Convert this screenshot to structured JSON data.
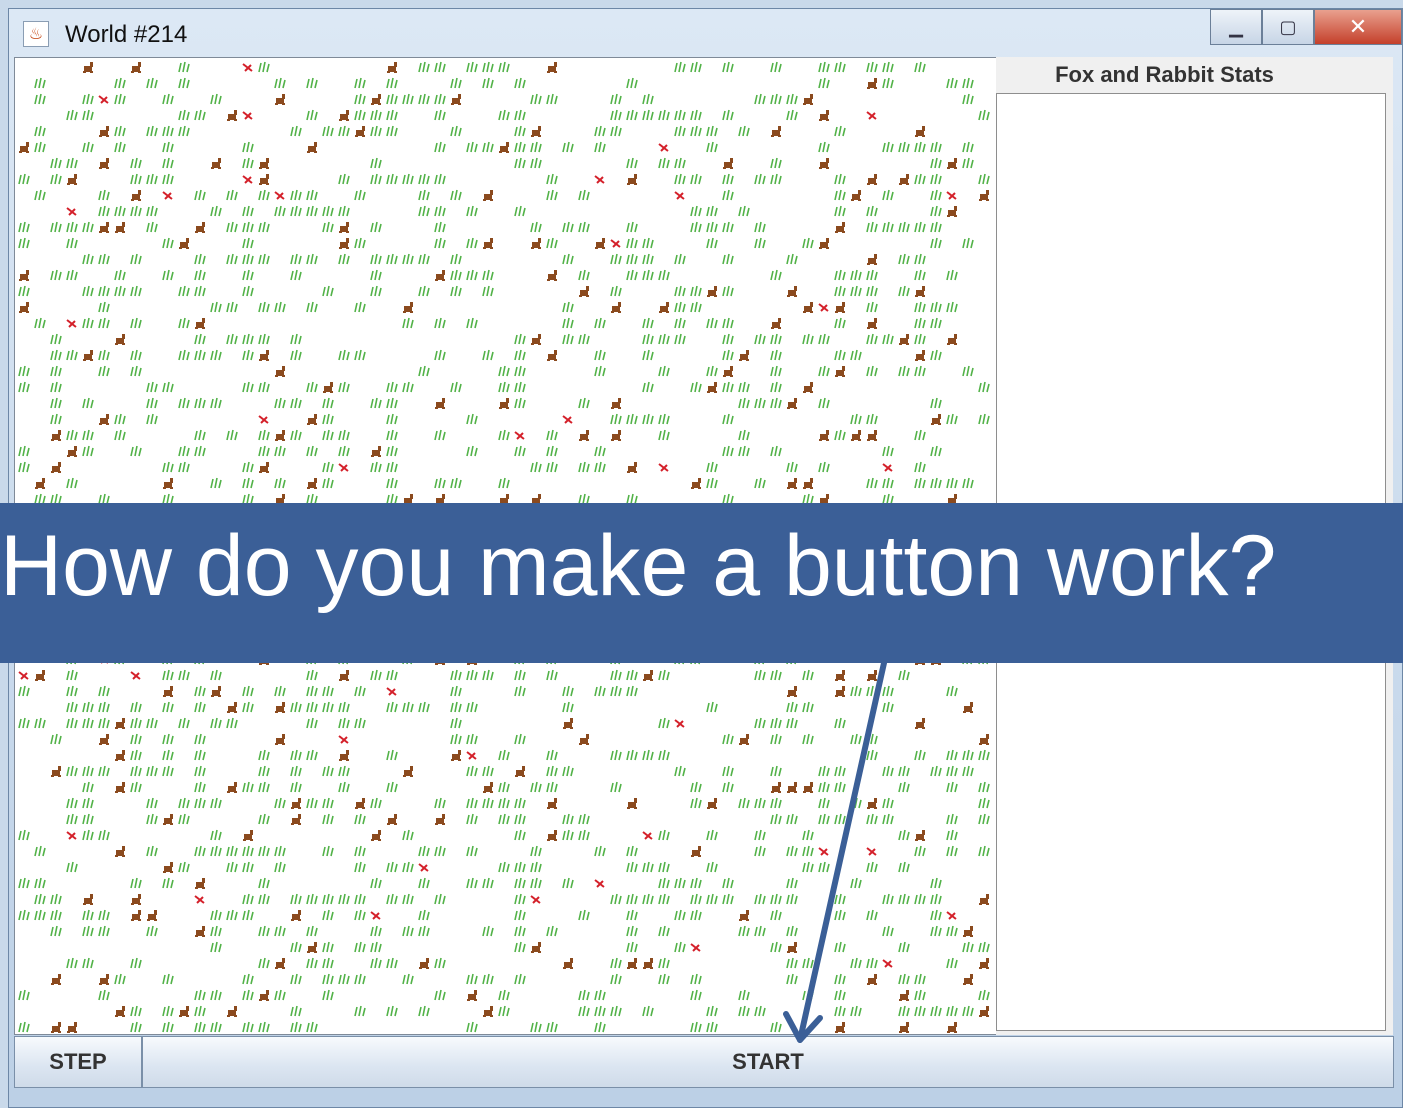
{
  "window": {
    "title": "World #214",
    "icon": "java-cup-icon"
  },
  "stats_panel": {
    "title": "Fox and Rabbit Stats",
    "content": ""
  },
  "buttons": {
    "step_label": "STEP",
    "start_label": "START"
  },
  "overlay": {
    "text": "How do you make a button work?",
    "background": "#3b5f97",
    "arrow_color": "#3b5f97"
  },
  "colors": {
    "grass": "#52b248",
    "rabbit": "#8b4a1e",
    "fox": "#d4202a",
    "grid_bg": "#ffffff"
  }
}
